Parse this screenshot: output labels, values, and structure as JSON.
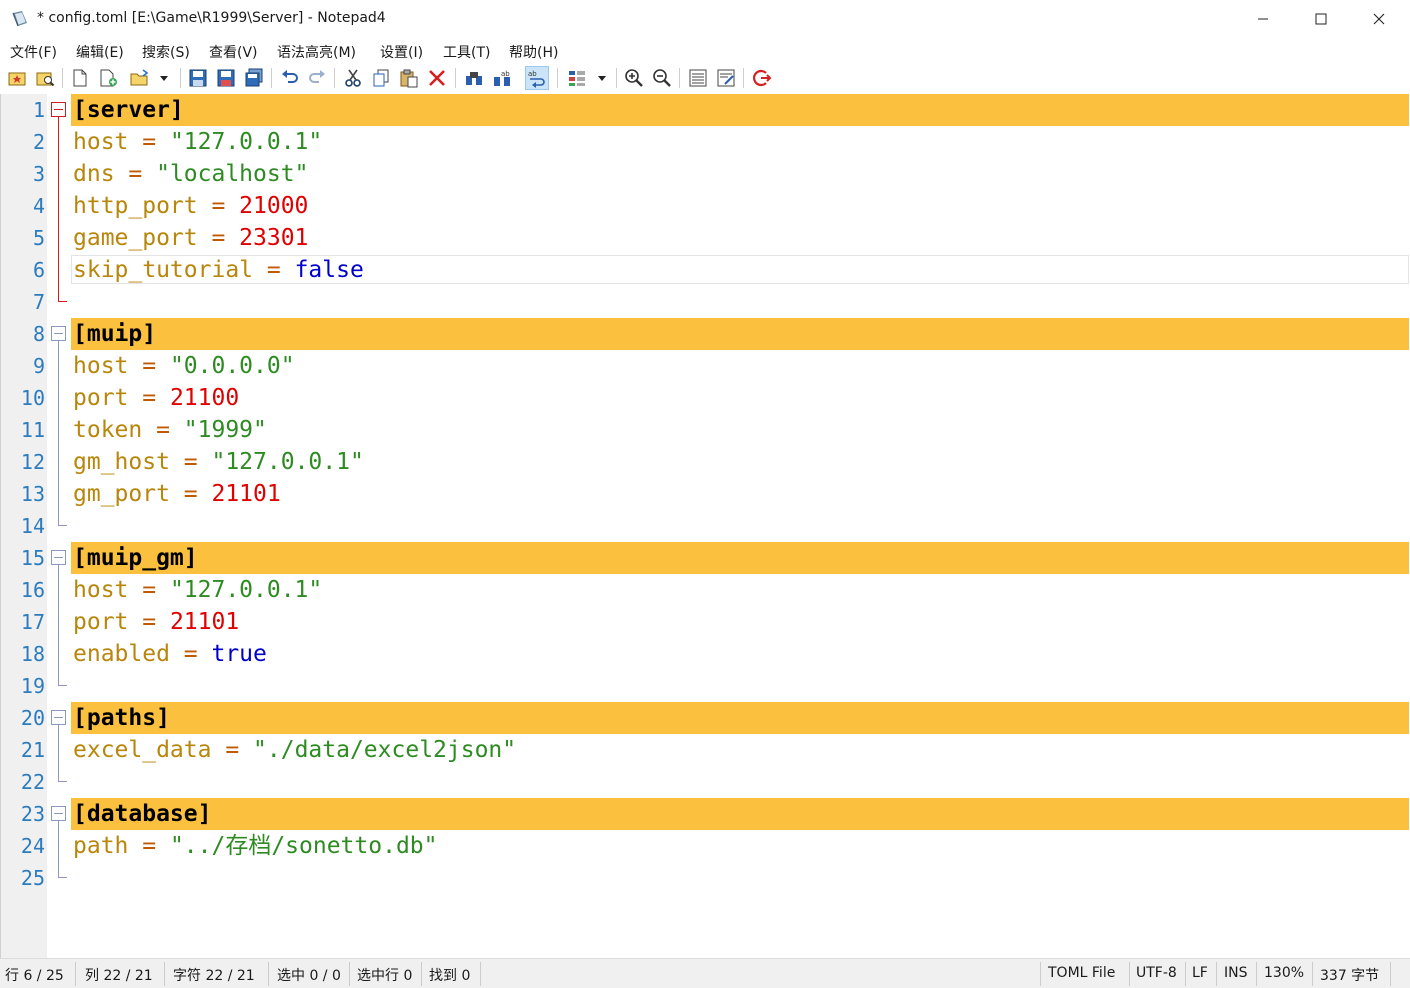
{
  "window": {
    "title": "* config.toml [E:\\Game\\R1999\\Server] - Notepad4"
  },
  "menu": [
    "文件(F)",
    "编辑(E)",
    "搜索(S)",
    "查看(V)",
    "语法高亮(M)",
    "设置(I)",
    "工具(T)",
    "帮助(H)"
  ],
  "toolbar": [
    {
      "icon": "favorites-icon"
    },
    {
      "icon": "browse-icon"
    },
    {
      "icon": "new-file-icon"
    },
    {
      "icon": "new-window-icon"
    },
    {
      "icon": "open-folder-icon"
    },
    {
      "icon": "dropdown-arrow-icon"
    },
    {
      "icon": "save-icon"
    },
    {
      "icon": "save-as-icon"
    },
    {
      "icon": "save-copy-icon"
    },
    {
      "icon": "undo-icon"
    },
    {
      "icon": "redo-icon"
    },
    {
      "icon": "cut-icon"
    },
    {
      "icon": "copy-icon"
    },
    {
      "icon": "paste-icon"
    },
    {
      "icon": "delete-icon"
    },
    {
      "icon": "find-icon"
    },
    {
      "icon": "replace-icon"
    },
    {
      "icon": "word-wrap-icon"
    },
    {
      "icon": "scheme-icon"
    },
    {
      "icon": "dropdown-arrow-icon"
    },
    {
      "icon": "zoom-in-icon"
    },
    {
      "icon": "zoom-out-icon"
    },
    {
      "icon": "settings-list-icon"
    },
    {
      "icon": "customize-icon"
    },
    {
      "icon": "exit-icon"
    }
  ],
  "editor": {
    "caret_line": 6,
    "lines": [
      {
        "num": "1",
        "section": "[server]"
      },
      {
        "num": "2",
        "key": "host",
        "value": "\"127.0.0.1\"",
        "type": "string"
      },
      {
        "num": "3",
        "key": "dns",
        "value": "\"localhost\"",
        "type": "string"
      },
      {
        "num": "4",
        "key": "http_port",
        "value": "21000",
        "type": "number"
      },
      {
        "num": "5",
        "key": "game_port",
        "value": "23301",
        "type": "number"
      },
      {
        "num": "6",
        "key": "skip_tutorial",
        "value": "false",
        "type": "bool"
      },
      {
        "num": "7"
      },
      {
        "num": "8",
        "section": "[muip]"
      },
      {
        "num": "9",
        "key": "host",
        "value": "\"0.0.0.0\"",
        "type": "string"
      },
      {
        "num": "10",
        "key": "port",
        "value": "21100",
        "type": "number"
      },
      {
        "num": "11",
        "key": "token",
        "value": "\"1999\"",
        "type": "string"
      },
      {
        "num": "12",
        "key": "gm_host",
        "value": "\"127.0.0.1\"",
        "type": "string"
      },
      {
        "num": "13",
        "key": "gm_port",
        "value": "21101",
        "type": "number"
      },
      {
        "num": "14"
      },
      {
        "num": "15",
        "section": "[muip_gm]"
      },
      {
        "num": "16",
        "key": "host",
        "value": "\"127.0.0.1\"",
        "type": "string"
      },
      {
        "num": "17",
        "key": "port",
        "value": "21101",
        "type": "number"
      },
      {
        "num": "18",
        "key": "enabled",
        "value": "true",
        "type": "bool"
      },
      {
        "num": "19"
      },
      {
        "num": "20",
        "section": "[paths]"
      },
      {
        "num": "21",
        "key": "excel_data",
        "value": "\"./data/excel2json\"",
        "type": "string"
      },
      {
        "num": "22"
      },
      {
        "num": "23",
        "section": "[database]"
      },
      {
        "num": "24",
        "key": "path",
        "value": "\"../存档/sonetto.db\"",
        "type": "string"
      },
      {
        "num": "25"
      }
    ]
  },
  "status": {
    "line": "行 6 / 25",
    "column": "列 22 / 21",
    "char": "字符 22 / 21",
    "selected": "选中 0 / 0",
    "selected_lines": "选中行 0",
    "found": "找到 0",
    "lexer": "TOML File",
    "encoding": "UTF-8",
    "eol": "LF",
    "ins": "INS",
    "zoom": "130%",
    "size": "337 字节"
  },
  "colors": {
    "section_highlight": "#fbc13e",
    "line_number": "#2b7bbd",
    "key": "#b8860b",
    "string": "#2e8b22",
    "number": "#e00000",
    "bool": "#0000cc"
  }
}
